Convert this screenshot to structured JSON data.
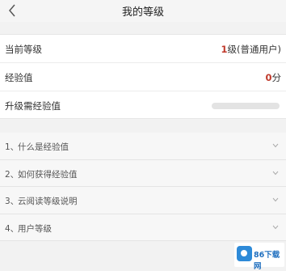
{
  "header": {
    "title": "我的等级",
    "back_icon": "chevron-left-icon"
  },
  "level_info": {
    "rows": [
      {
        "label": "当前等级",
        "value_prefix": "1",
        "value_suffix": "级(普通用户)"
      },
      {
        "label": "经验值",
        "value_prefix": "0",
        "value_suffix": "分"
      },
      {
        "label": "升级需经验值",
        "progress": 0
      }
    ]
  },
  "faq": {
    "items": [
      {
        "num": "1、",
        "text": "什么是经验值"
      },
      {
        "num": "2、",
        "text": "如何获得经验值"
      },
      {
        "num": "3、",
        "text": "云阅读等级说明"
      },
      {
        "num": "4、",
        "text": "用户等级"
      }
    ],
    "expand_icon": "chevron-down-icon"
  },
  "watermark": {
    "text": "86下载网"
  },
  "colors": {
    "accent": "#c0392b",
    "background": "#f2f2f2"
  }
}
